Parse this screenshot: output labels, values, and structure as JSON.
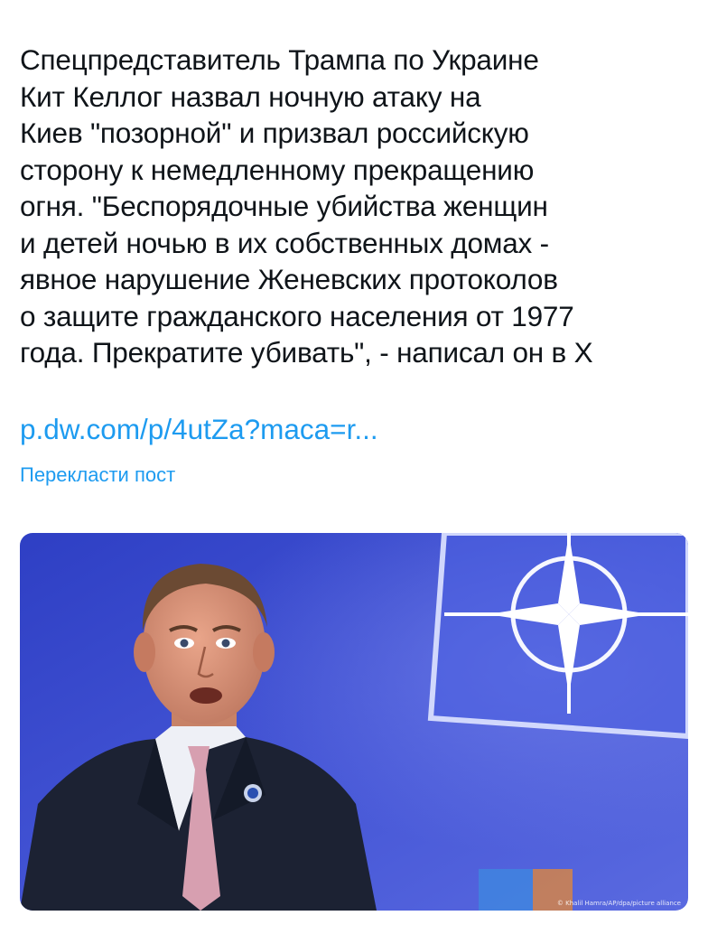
{
  "post": {
    "text_lines": [
      "Спецпредставитель Трампа по Украине",
      "Кит Келлог назвал ночную атаку на",
      "Киев \"позорной\" и призвал российскую",
      "сторону к немедленному прекращению",
      "огня. \"Беспорядочные убийства женщин",
      "и детей ночью в их собственных домах -",
      "явное нарушение Женевских протоколов",
      "о защите гражданского населения от 1977",
      "года. Прекратите убивать\", - написал он в Х"
    ],
    "link": "p.dw.com/p/4utZa?maca=r...",
    "translate_label": "Перекласти пост"
  },
  "media": {
    "credit": "© Khalil Hamra/AP/dpa/picture alliance"
  },
  "colors": {
    "text": "#0f1419",
    "link": "#1d9bf0",
    "photo_background": "#3d4fd0",
    "emblem": "#ffffff"
  },
  "icons": {
    "photo_emblem": "nato-compass-rose-icon",
    "lapel_pin": "lapel-pin-icon"
  }
}
